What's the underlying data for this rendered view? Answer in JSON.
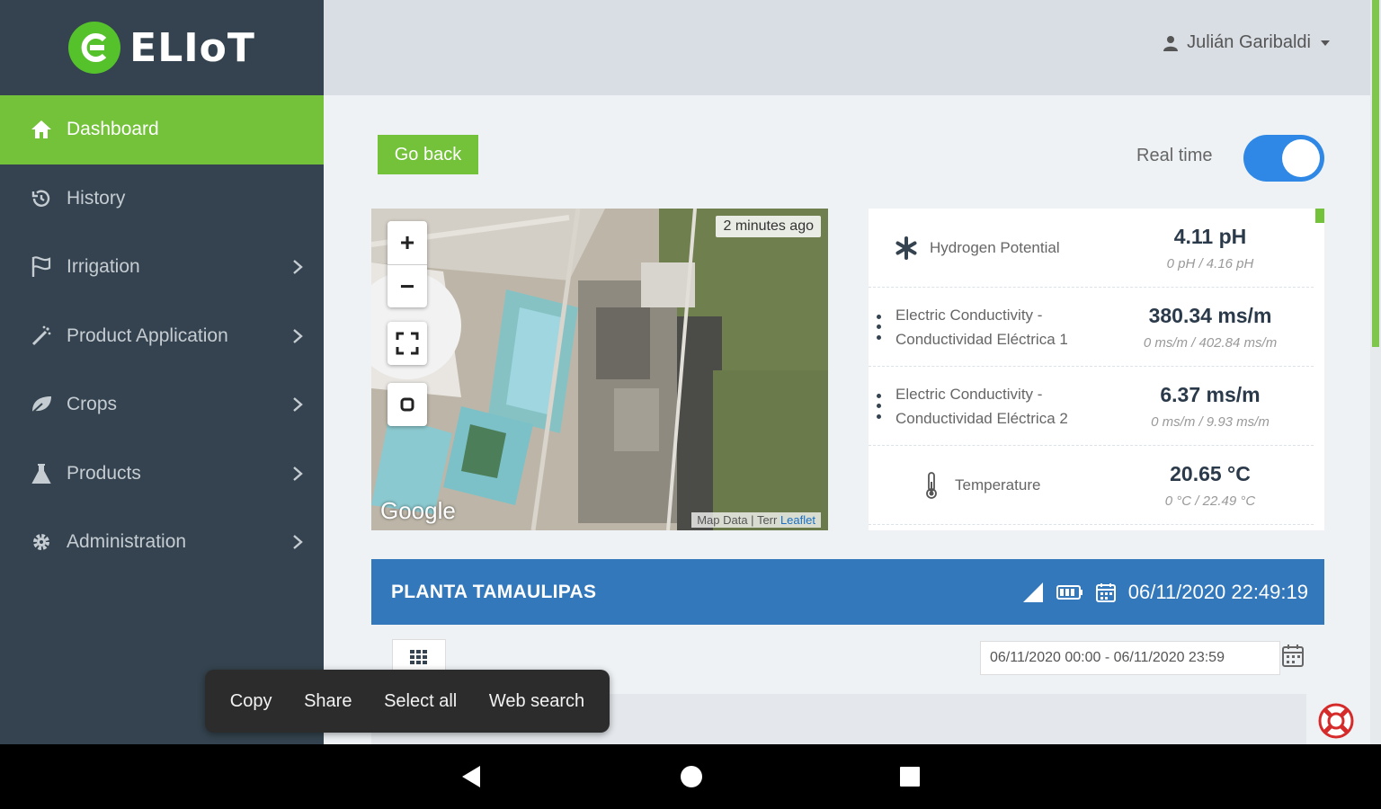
{
  "app": {
    "brand": "ELIoT",
    "brand_color": "#73c23a"
  },
  "sidebar": {
    "items": [
      {
        "label": "Dashboard",
        "icon": "home-icon",
        "active": true,
        "has_children": false
      },
      {
        "label": "History",
        "icon": "history-icon",
        "active": false,
        "has_children": false
      },
      {
        "label": "Irrigation",
        "icon": "irrigation-icon",
        "active": false,
        "has_children": true
      },
      {
        "label": "Product Application",
        "icon": "spray-icon",
        "active": false,
        "has_children": true
      },
      {
        "label": "Crops",
        "icon": "leaf-icon",
        "active": false,
        "has_children": true
      },
      {
        "label": "Products",
        "icon": "flask-icon",
        "active": false,
        "has_children": true
      },
      {
        "label": "Administration",
        "icon": "gear-icon",
        "active": false,
        "has_children": true
      }
    ]
  },
  "header": {
    "user_name": "Julián Garibaldi"
  },
  "controls": {
    "go_back_label": "Go back",
    "realtime_label": "Real time",
    "realtime_on": true
  },
  "map": {
    "updated": "2 minutes ago",
    "zoom_in": "+",
    "zoom_out": "−",
    "google_label": "Google",
    "attribution_map": "Map Data",
    "attribution_terms": "Terr",
    "attribution_leaflet": "Leaflet"
  },
  "sensors": [
    {
      "name_line1": "Hydrogen Potential",
      "name_line2": "",
      "value": "4.11 pH",
      "range": "0 pH / 4.16 pH",
      "icon": "asterisk-icon"
    },
    {
      "name_line1": "Electric Conductivity -",
      "name_line2": "Conductividad Eléctrica 1",
      "value": "380.34 ms/m",
      "range": "0 ms/m / 402.84 ms/m",
      "icon": "kebab-icon"
    },
    {
      "name_line1": "Electric Conductivity -",
      "name_line2": "Conductividad Eléctrica 2",
      "value": "6.37 ms/m",
      "range": "0 ms/m / 9.93 ms/m",
      "icon": "kebab-icon"
    },
    {
      "name_line1": "Temperature",
      "name_line2": "",
      "value": "20.65 °C",
      "range": "0 °C / 22.49 °C",
      "icon": "thermometer-icon"
    }
  ],
  "station": {
    "name": "PLANTA TAMAULIPAS",
    "timestamp": "06/11/2020 22:49:19",
    "date_range": "06/11/2020 00:00 - 06/11/2020 23:59",
    "color": "#3278bb"
  },
  "context_menu": {
    "items": [
      "Copy",
      "Share",
      "Select all",
      "Web search"
    ]
  }
}
